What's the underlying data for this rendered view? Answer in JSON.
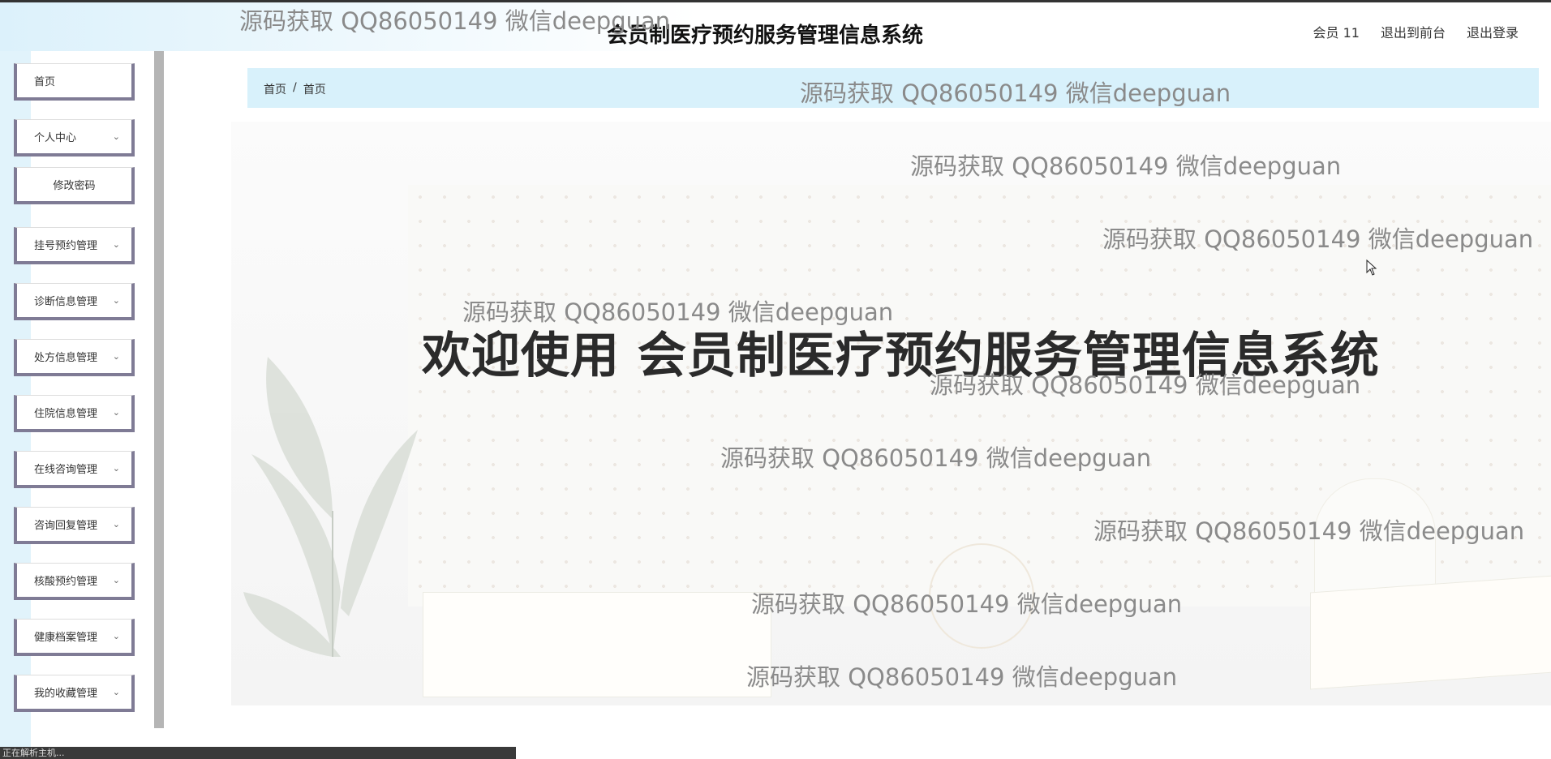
{
  "header": {
    "title": "会员制医疗预约服务管理信息系统",
    "actions": [
      "会员 11",
      "退出到前台",
      "退出登录"
    ]
  },
  "sidebar": {
    "items": [
      {
        "label": "首页",
        "expandable": false
      },
      {
        "label": "个人中心",
        "expandable": true
      },
      {
        "label": "修改密码",
        "expandable": false,
        "sub": true
      },
      {
        "label": "挂号预约管理",
        "expandable": true
      },
      {
        "label": "诊断信息管理",
        "expandable": true
      },
      {
        "label": "处方信息管理",
        "expandable": true
      },
      {
        "label": "住院信息管理",
        "expandable": true
      },
      {
        "label": "在线咨询管理",
        "expandable": true
      },
      {
        "label": "咨询回复管理",
        "expandable": true
      },
      {
        "label": "核酸预约管理",
        "expandable": true
      },
      {
        "label": "健康档案管理",
        "expandable": true
      },
      {
        "label": "我的收藏管理",
        "expandable": true
      }
    ]
  },
  "breadcrumb": {
    "items": [
      "首页",
      "首页"
    ],
    "separator": "/"
  },
  "main": {
    "welcome": "欢迎使用 会员制医疗预约服务管理信息系统"
  },
  "watermark": {
    "text": "源码获取 QQ86050149 微信deepguan",
    "header_text": "源码获取 QQ86050149 微信deepguan"
  },
  "statusbar": {
    "text": "正在解析主机..."
  }
}
